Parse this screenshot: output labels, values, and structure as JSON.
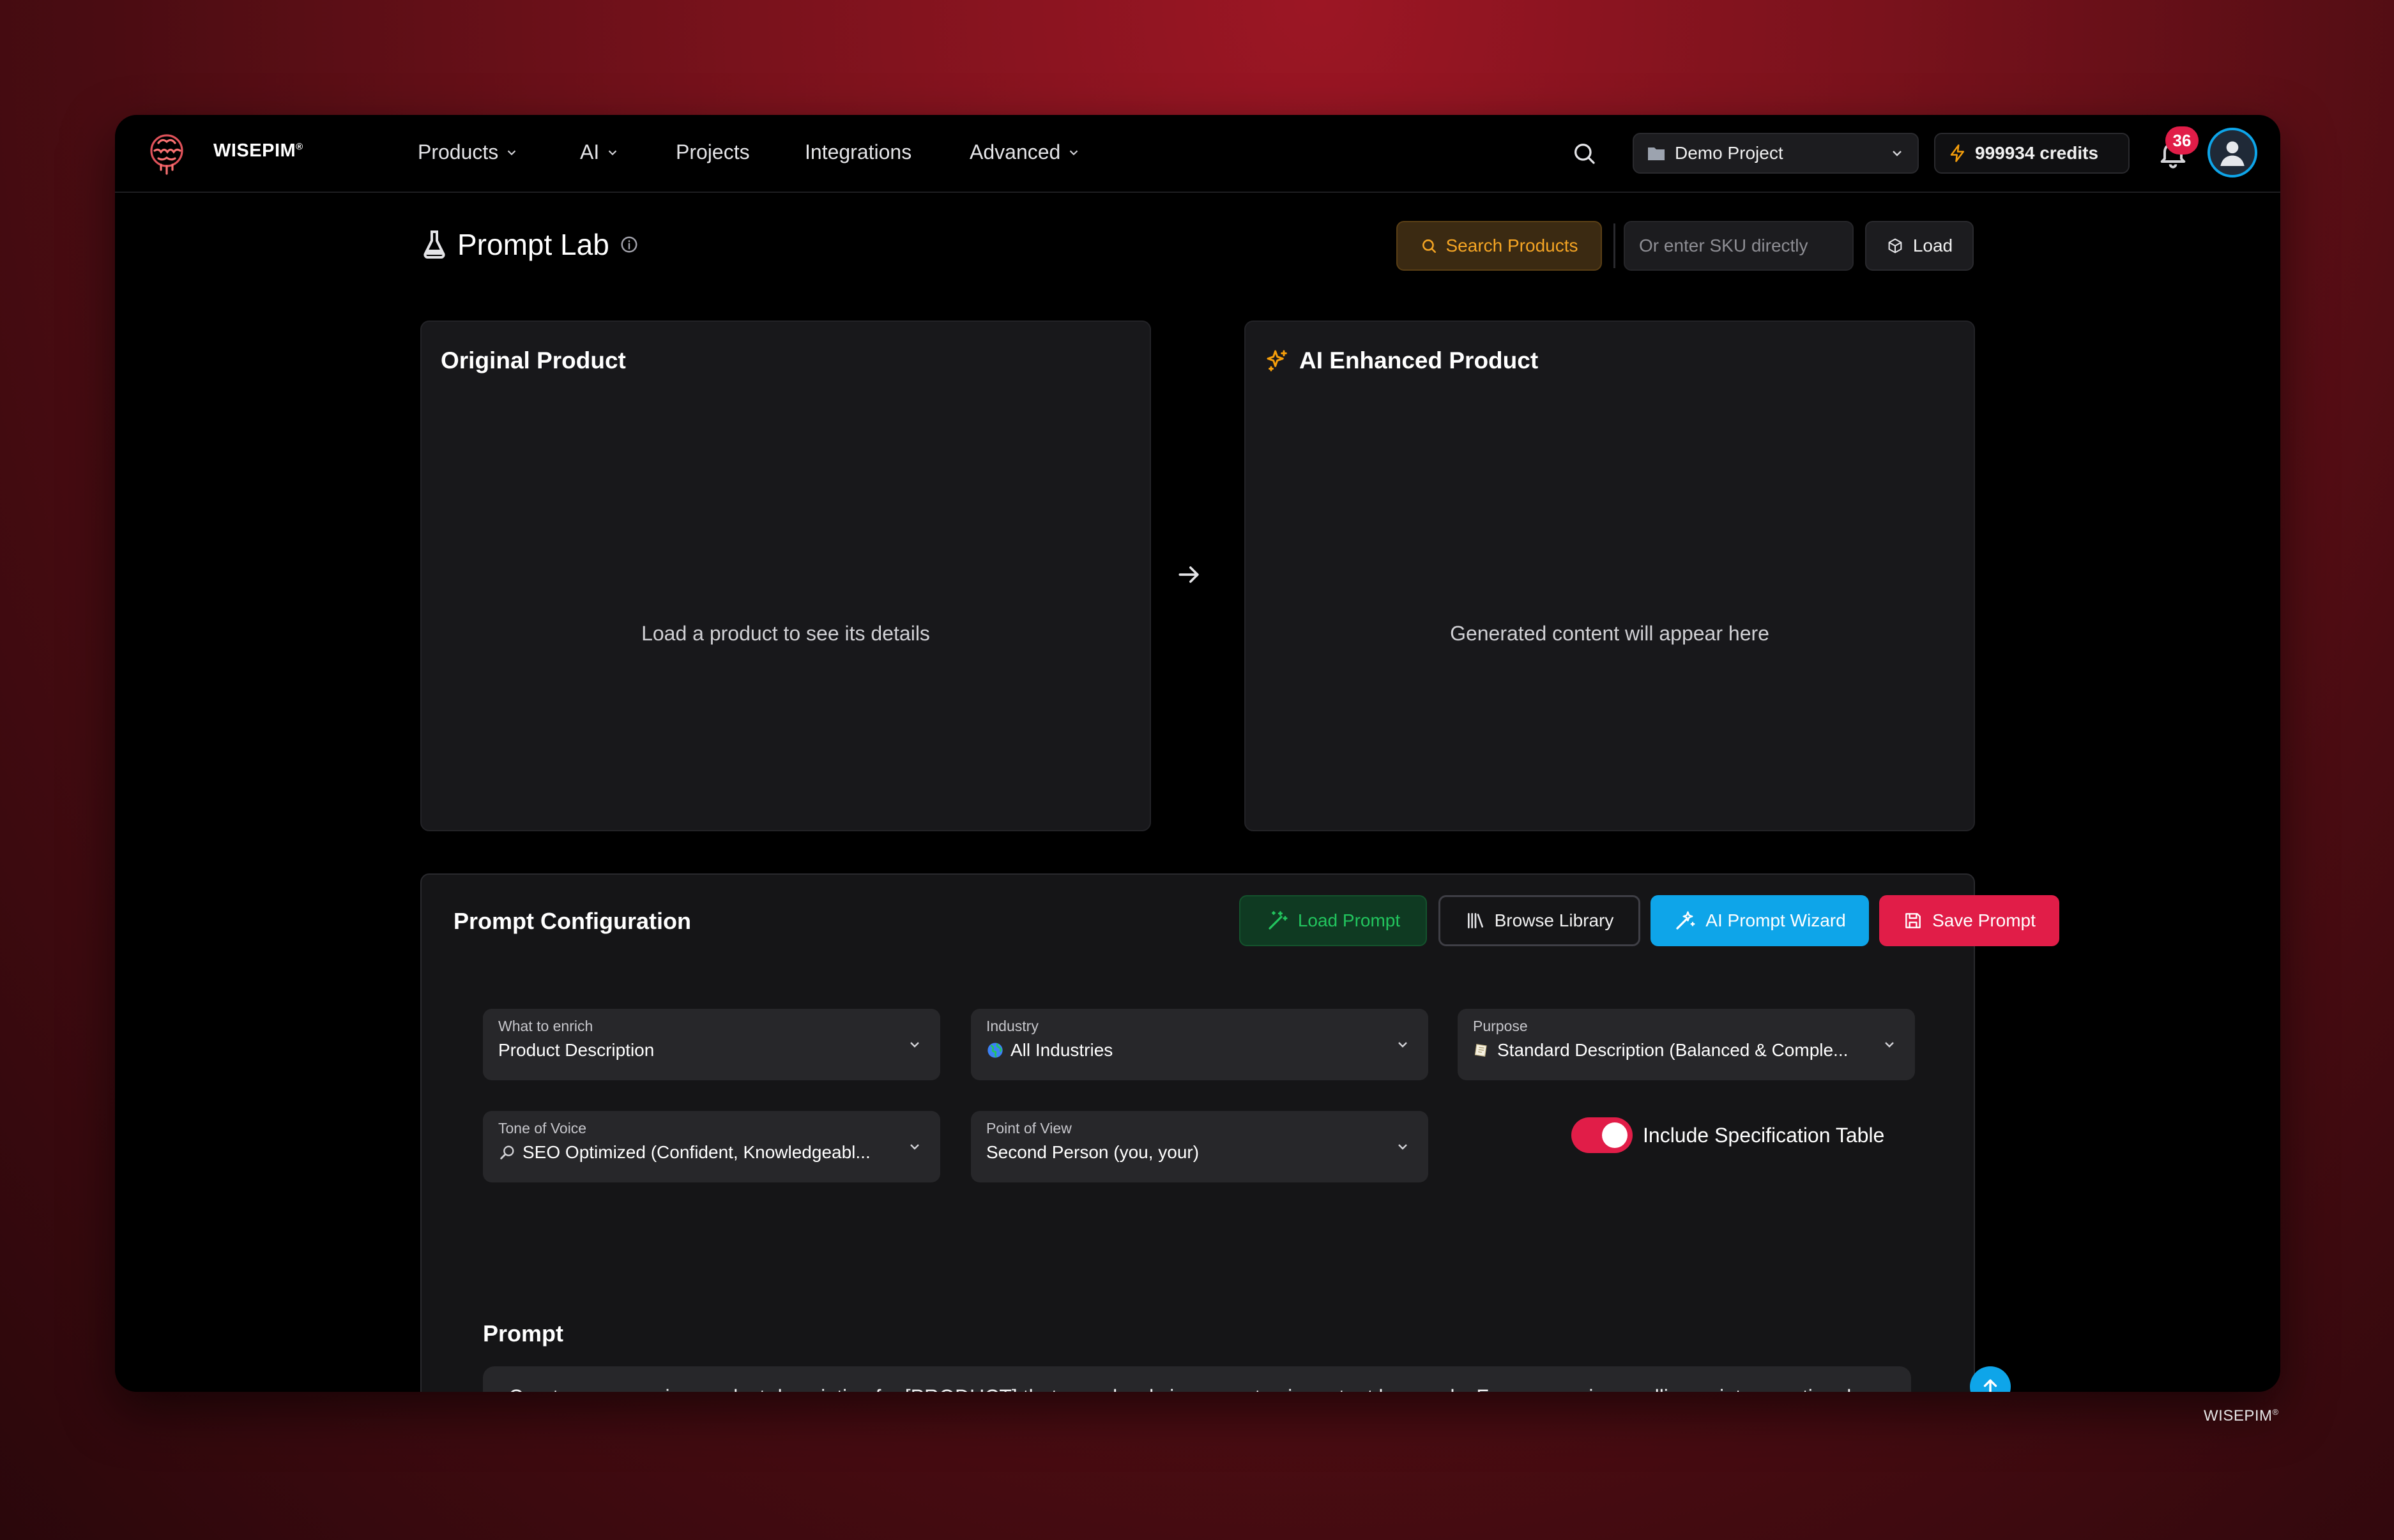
{
  "app": {
    "brand": "WISEPIM",
    "brand_mark": "®"
  },
  "nav": {
    "items": [
      {
        "label": "Products",
        "has_dropdown": true
      },
      {
        "label": "AI",
        "has_dropdown": true
      },
      {
        "label": "Projects",
        "has_dropdown": false
      },
      {
        "label": "Integrations",
        "has_dropdown": false
      },
      {
        "label": "Advanced",
        "has_dropdown": true
      }
    ],
    "project": "Demo Project",
    "credits": "999934 credits",
    "notifications_count": "36"
  },
  "page": {
    "title": "Prompt Lab",
    "search_products_label": "Search Products",
    "sku_placeholder": "Or enter SKU directly",
    "load_label": "Load"
  },
  "original_card": {
    "title": "Original Product",
    "empty_text": "Load a product to see its details"
  },
  "enhanced_card": {
    "title": "AI Enhanced Product",
    "empty_text": "Generated content will appear here"
  },
  "config": {
    "title": "Prompt Configuration",
    "load_prompt_label": "Load Prompt",
    "browse_library_label": "Browse Library",
    "wizard_label": "AI Prompt Wizard",
    "save_prompt_label": "Save Prompt",
    "fields": {
      "enrich": {
        "label": "What to enrich",
        "value": "Product Description"
      },
      "industry": {
        "label": "Industry",
        "value": "All Industries",
        "icon": "globe-icon"
      },
      "purpose": {
        "label": "Purpose",
        "value": "Standard Description (Balanced & Comple...",
        "icon": "note-icon"
      },
      "tone": {
        "label": "Tone of Voice",
        "value": "SEO Optimized (Confident, Knowledgeabl...",
        "icon": "magnifier-icon"
      },
      "pov": {
        "label": "Point of View",
        "value": "Second Person (you, your)"
      }
    },
    "spec_table_label": "Include Specification Table",
    "spec_table_enabled": true,
    "prompt_label": "Prompt",
    "prompt_text": "Create a persuasive product description for [PRODUCT] that seamlessly incorporates important keywords. Focus on unique selling points, emotional benefits, and practical advantages. Include specific features, materials, and use cases. Target length: 150-200 words. Structure: Opening hook → Key benefits → Features → Social proof elements → Call to action."
  },
  "footer": {
    "brand": "WISEPIM",
    "brand_mark": "®"
  },
  "colors": {
    "accent_blue": "#0ea5e9",
    "accent_red": "#e11d48",
    "accent_green": "#22c55e",
    "accent_amber": "#f5a524"
  }
}
